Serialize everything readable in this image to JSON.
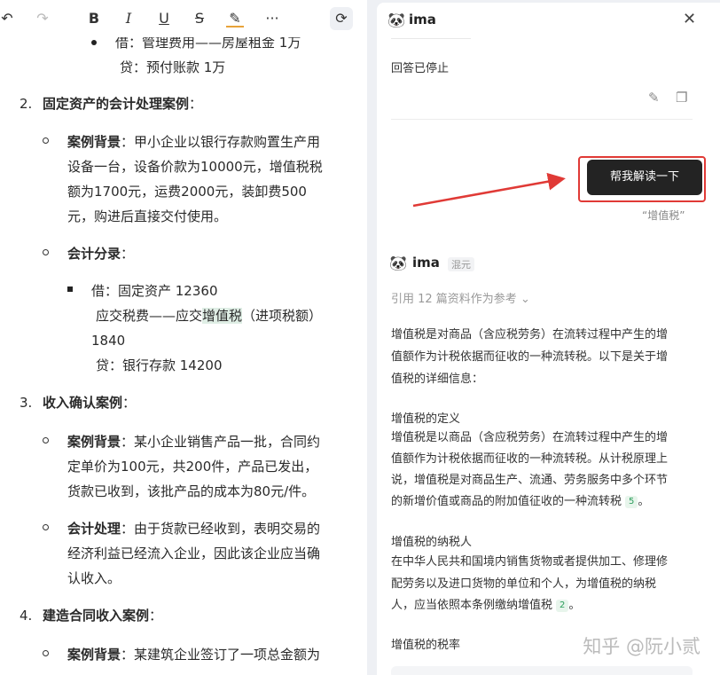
{
  "toolbar": {
    "undo": "↶",
    "redo": "↷",
    "bold": "B",
    "italic": "I",
    "underline": "U",
    "strike": "S",
    "highlight": "✎",
    "more": "···",
    "refresh": "⟳"
  },
  "doc": {
    "l1": "借：管理费用——房屋租金 1万",
    "l2": "贷：预付账款 1万",
    "s2_num": "2.",
    "s2_title": "固定资产的会计处理案例",
    "colon": "：",
    "s2_bg_label": "案例背景",
    "s2_bg_1": "甲小企业以银行存款购置生产用",
    "s2_bg_2": "设备一台，设备价款为10000元，增值税税",
    "s2_bg_3": "额为1700元，运费2000元，装卸费500",
    "s2_bg_4": "元，购进后直接交付使用。",
    "s2_entry_label": "会计分录",
    "s2_e1": "借：固定资产 12360",
    "s2_e2_a": "应交税费——应交",
    "s2_e2_hl": "增值税",
    "s2_e2_b": "（进项税额）",
    "s2_e3": "1840",
    "s2_e4": "贷：银行存款 14200",
    "s3_num": "3.",
    "s3_title": "收入确认案例",
    "s3_bg_label": "案例背景",
    "s3_bg_1": "某小企业销售产品一批，合同约",
    "s3_bg_2": "定单价为100元，共200件，产品已发出，",
    "s3_bg_3": "货款已收到，该批产品的成本为80元/件。",
    "s3_proc_label": "会计处理",
    "s3_proc_1": "由于货款已经收到，表明交易的",
    "s3_proc_2": "经济利益已经流入企业，因此该企业应当确",
    "s3_proc_3": "认收入。",
    "s4_num": "4.",
    "s4_title": "建造合同收入案例",
    "s4_bg_label": "案例背景",
    "s4_bg_1": "某建筑企业签订了一项总金额为"
  },
  "panel": {
    "app_name": "ima",
    "close": "✕",
    "stopped": "回答已停止",
    "edit_icon": "✎",
    "copy_icon": "❐",
    "user_message": "帮我解读一下",
    "quote": "“增值税”",
    "bot_name": "ima",
    "bot_badge": "混元",
    "ref": "引用 12 篇资料作为参考 ⌄",
    "p1": [
      "增值税是对商品（含应税劳务）在流转过程中产生的增",
      "值额作为计税依据而征收的一种流转税。以下是关于增",
      "值税的详细信息："
    ],
    "h1": "增值税的定义",
    "p2": [
      "增值税是以商品（含应税劳务）在流转过程中产生的增",
      "值额作为计税依据而征收的一种流转税。从计税原理上",
      "说，增值税是对商品生产、流通、劳务服务中多个环节",
      "的新增价值或商品的附加值征收的一种流转税"
    ],
    "p2_cite": "5",
    "p2_end": "。",
    "h2": "增值税的纳税人",
    "p3": [
      "在中华人民共和国境内销售货物或者提供加工、修理修",
      "配劳务以及进口货物的单位和个人，为增值税的纳税",
      "人，应当依照本条例缴纳增值税"
    ],
    "p3_cite": "2",
    "p3_end": "。",
    "h3": "增值税的税率"
  },
  "watermark": "知乎 @阮小贰",
  "colors": {
    "accent_red": "#e03a36",
    "button_bg": "#232323",
    "highlight": "#dfeee5"
  }
}
